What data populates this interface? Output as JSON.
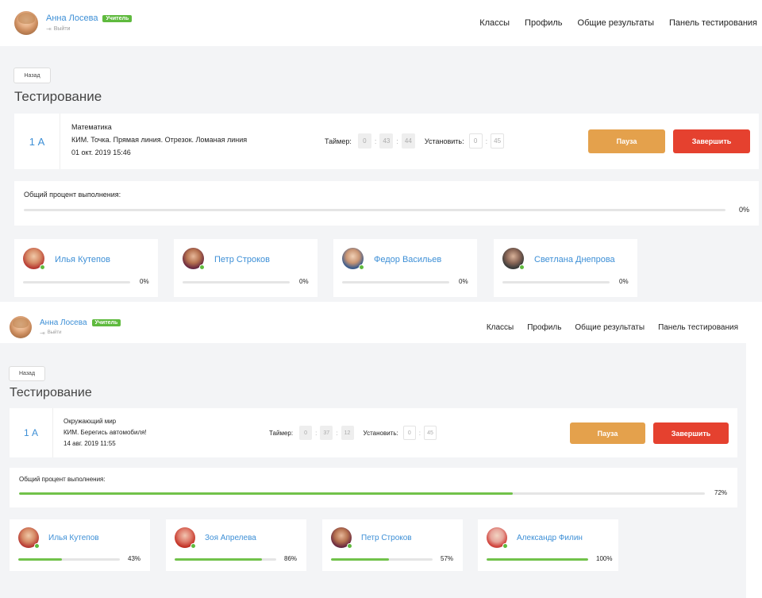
{
  "screens": [
    {
      "header": {
        "user_name": "Анна Лосева",
        "role": "Учитель",
        "logout": "Выйти",
        "nav": [
          "Классы",
          "Профиль",
          "Общие результаты",
          "Панель тестирования"
        ]
      },
      "back_label": "Назад",
      "title": "Тестирование",
      "test": {
        "class_code": "1 А",
        "subject": "Математика",
        "topic": "КИМ. Точка. Прямая линия. Отрезок. Ломаная линия",
        "datetime": "01 окт. 2019 15:46",
        "timer_label": "Таймер:",
        "timer": [
          "0",
          "43",
          "44"
        ],
        "set_label": "Установить:",
        "set": [
          "0",
          "45"
        ],
        "pause_label": "Пауза",
        "finish_label": "Завершить"
      },
      "overall": {
        "label": "Общий процент выполнения:",
        "percent": 0,
        "percent_text": "0%"
      },
      "students": [
        {
          "name": "Илья Кутепов",
          "percent": 0,
          "percent_text": "0%"
        },
        {
          "name": "Петр Строков",
          "percent": 0,
          "percent_text": "0%"
        },
        {
          "name": "Федор Васильев",
          "percent": 0,
          "percent_text": "0%"
        },
        {
          "name": "Светлана Днепрова",
          "percent": 0,
          "percent_text": "0%"
        }
      ]
    },
    {
      "header": {
        "user_name": "Анна Лосева",
        "role": "Учитель",
        "logout": "Выйти",
        "nav": [
          "Классы",
          "Профиль",
          "Общие результаты",
          "Панель тестирования"
        ]
      },
      "back_label": "Назад",
      "title": "Тестирование",
      "test": {
        "class_code": "1 А",
        "subject": "Окружающий мир",
        "topic": "КИМ. Берегись автомобиля!",
        "datetime": "14 авг. 2019 11:55",
        "timer_label": "Таймер:",
        "timer": [
          "0",
          "37",
          "12"
        ],
        "set_label": "Установить:",
        "set": [
          "0",
          "45"
        ],
        "pause_label": "Пауза",
        "finish_label": "Завершить"
      },
      "overall": {
        "label": "Общий процент выполнения:",
        "percent": 72,
        "percent_text": "72%"
      },
      "students": [
        {
          "name": "Илья Кутепов",
          "percent": 43,
          "percent_text": "43%"
        },
        {
          "name": "Зоя Апрелева",
          "percent": 86,
          "percent_text": "86%"
        },
        {
          "name": "Петр Строков",
          "percent": 57,
          "percent_text": "57%"
        },
        {
          "name": "Александр Филин",
          "percent": 100,
          "percent_text": "100%"
        }
      ]
    }
  ],
  "colors": {
    "accent": "#3d8fd6",
    "badge": "#5fba3e",
    "progress": "#71c24a",
    "pause": "#e4a14c",
    "finish": "#e5412f",
    "background": "#f3f4f6"
  }
}
